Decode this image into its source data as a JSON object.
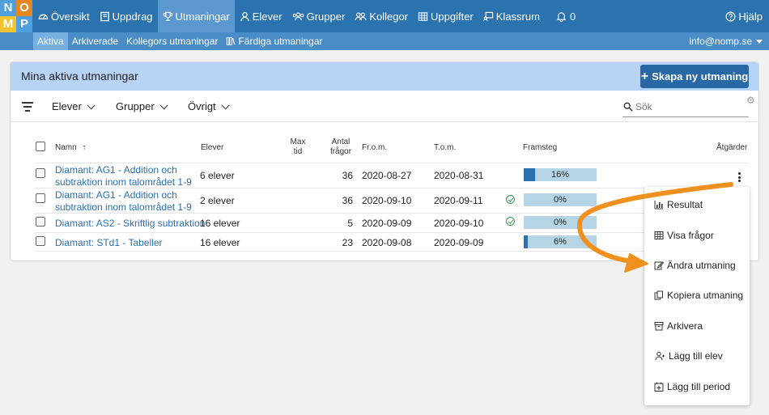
{
  "logo": {
    "letters": [
      "N",
      "O",
      "M",
      "P"
    ],
    "colors": [
      "#4f9fe0",
      "#e8871e",
      "#f2c230",
      "#4f9fe0"
    ]
  },
  "nav": {
    "items": [
      {
        "label": "Översikt",
        "icon": "dashboard-icon",
        "active": false
      },
      {
        "label": "Uppdrag",
        "icon": "book-icon",
        "active": false
      },
      {
        "label": "Utmaningar",
        "icon": "trophy-icon",
        "active": true
      },
      {
        "label": "Elever",
        "icon": "user-icon",
        "active": false
      },
      {
        "label": "Grupper",
        "icon": "users-icon",
        "active": false
      },
      {
        "label": "Kollegor",
        "icon": "colleagues-icon",
        "active": false
      },
      {
        "label": "Uppgifter",
        "icon": "grid-icon",
        "active": false
      },
      {
        "label": "Klassrum",
        "icon": "classroom-icon",
        "active": false
      },
      {
        "label": "0",
        "icon": "bell-icon",
        "active": false
      }
    ],
    "help": "Hjälp"
  },
  "subnav": {
    "items": [
      {
        "label": "Aktiva",
        "active": true
      },
      {
        "label": "Arkiverade",
        "active": false
      },
      {
        "label": "Kollegors utmaningar",
        "active": false
      },
      {
        "label": "Färdiga utmaningar",
        "active": false,
        "icon": "books-icon"
      }
    ],
    "account": "info@nomp.se"
  },
  "card": {
    "title": "Mina aktiva utmaningar",
    "create_button": "Skapa ny utmaning"
  },
  "filters": {
    "students": "Elever",
    "groups": "Grupper",
    "other": "Övrigt",
    "search_placeholder": "Sök"
  },
  "table": {
    "headers": {
      "name": "Namn",
      "students": "Elever",
      "max_time": "Max\ntid",
      "question_count": "Antal\nfrågor",
      "from": "Fr.o.m.",
      "to": "T.o.m.",
      "progress": "Framsteg",
      "actions": "Åtgärder"
    },
    "rows": [
      {
        "name": "Diamant: AG1 - Addition och\nsubtraktion inom talområdet 1-9",
        "students": "6 elever",
        "questions": "36",
        "from": "2020-08-27",
        "to": "2020-08-31",
        "progress": 16,
        "progress_label": "16%",
        "done": false
      },
      {
        "name": "Diamant: AG1 - Addition och\nsubtraktion inom talområdet 1-9",
        "students": "2 elever",
        "questions": "36",
        "from": "2020-09-10",
        "to": "2020-09-11",
        "progress": 0,
        "progress_label": "0%",
        "done": true
      },
      {
        "name": "Diamant: AS2 - Skriftlig subtraktion",
        "students": "16 elever",
        "questions": "5",
        "from": "2020-09-09",
        "to": "2020-09-10",
        "progress": 0,
        "progress_label": "0%",
        "done": true
      },
      {
        "name": "Diamant: STd1 - Tabeller",
        "students": "16 elever",
        "questions": "23",
        "from": "2020-09-08",
        "to": "2020-09-09",
        "progress": 6,
        "progress_label": "6%",
        "done": false
      }
    ]
  },
  "menu": {
    "items": [
      {
        "label": "Resultat",
        "icon": "bar-chart-icon"
      },
      {
        "label": "Visa frågor",
        "icon": "table-icon"
      },
      {
        "label": "Ändra utmaning",
        "icon": "edit-icon"
      },
      {
        "label": "Kopiera utmaning",
        "icon": "copy-icon"
      },
      {
        "label": "Arkivera",
        "icon": "archive-icon"
      },
      {
        "label": "Lägg till elev",
        "icon": "add-user-icon"
      },
      {
        "label": "Lägg till period",
        "icon": "add-calendar-icon"
      }
    ]
  },
  "colors": {
    "nav": "#2b73af",
    "subnav": "#4a8cc5",
    "card_head": "#b7d4f7",
    "button": "#2868a4",
    "annotation_arrow": "#f0901e",
    "progress_fill": "#2672b2",
    "progress_bg": "#b5d5e6"
  }
}
